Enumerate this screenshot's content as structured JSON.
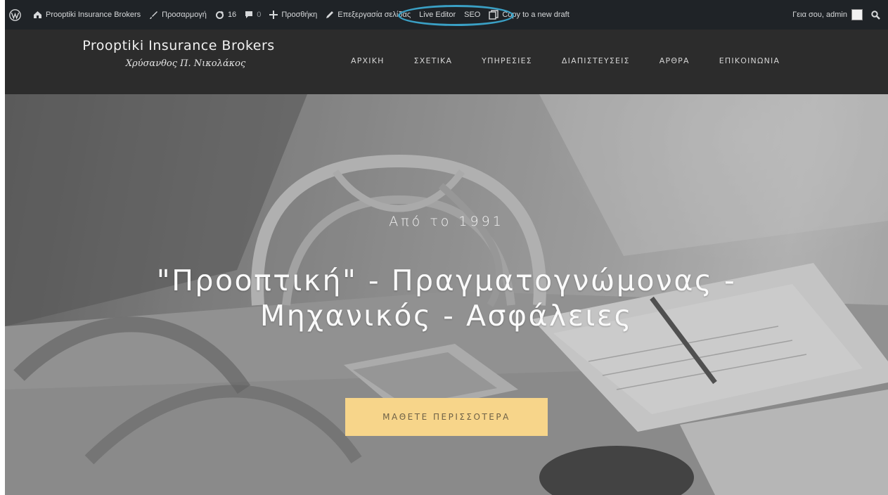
{
  "adminbar": {
    "site_name": "Prooptiki Insurance Brokers",
    "customize": "Προσαρμογή",
    "updates_count": "16",
    "comments_count": "0",
    "new_item": "Προσθήκη",
    "edit_page": "Επεξεργασία σελίδας",
    "live_editor": "Live Editor",
    "seo": "SEO",
    "copy_draft": "Copy to a new draft",
    "greeting": "Γεια σου, admin"
  },
  "site": {
    "title": "Prooptiki Insurance Brokers",
    "subtitle": "Χρύσανθος Π. Νικολάκος"
  },
  "nav": {
    "items": [
      "ΑΡΧΙΚΗ",
      "ΣΧΕΤΙΚΑ",
      "ΥΠΗΡΕΣΙΕΣ",
      "ΔΙΑΠΙΣΤΕΥΣΕΙΣ",
      "ΑΡΘΡΑ",
      "ΕΠΙΚΟΙΝΩΝΙΑ"
    ]
  },
  "hero": {
    "eyebrow": "Από το 1991",
    "title": "\"Προοπτική\" - Πραγματογνώμονας - Μηχανικός - Ασφάλειες",
    "button": "ΜΑΘΕΤΕ ΠΕΡΙΣΣΟΤΕΡΑ"
  },
  "colors": {
    "adminbar_bg": "#1f2327",
    "header_bg": "#2c2c2c",
    "cta_bg": "#f7d58a",
    "highlight_ring": "#3aa0c5"
  },
  "icons": {
    "wp_logo": "wordpress-logo-icon",
    "site": "dashboard-icon",
    "customize": "brush-icon",
    "updates": "refresh-icon",
    "comments": "comment-icon",
    "new": "plus-icon",
    "edit": "pencil-icon",
    "copy": "copy-icon",
    "search": "search-icon"
  }
}
